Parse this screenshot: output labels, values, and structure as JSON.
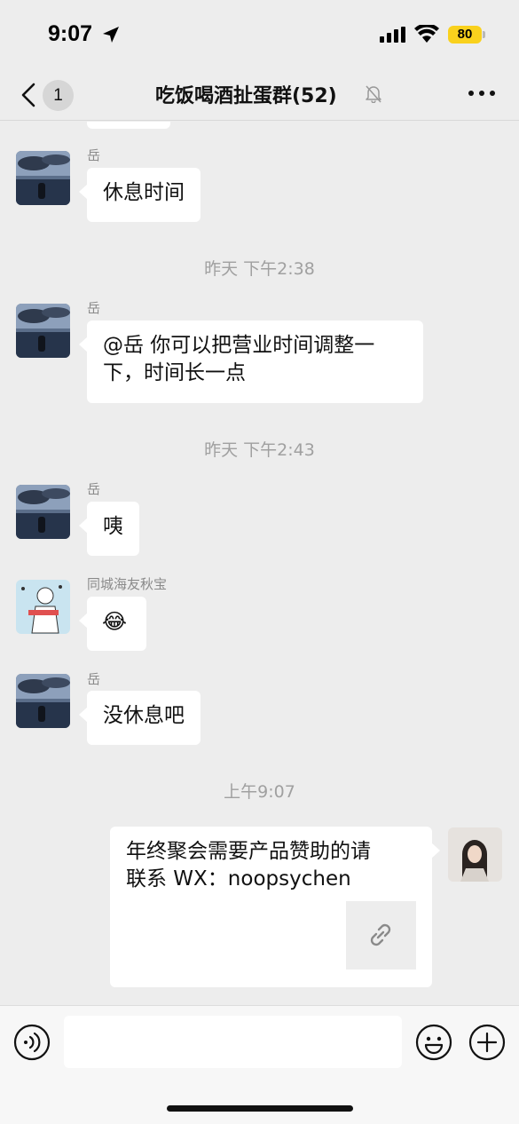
{
  "status_bar": {
    "time": "9:07",
    "battery": "80",
    "battery_color": "#f9d11d"
  },
  "nav": {
    "back_count": "1",
    "title": "吃饭喝酒扯蛋群(52)",
    "mute_icon": "bell-slash-icon",
    "more_icon": "more-dots-icon"
  },
  "messages": [
    {
      "sender": "岳",
      "text": "休息时间"
    },
    {
      "timestamp": "昨天 下午2:38"
    },
    {
      "sender": "岳",
      "text_line1": "@岳 你可以把营业时间调整一",
      "text_line2": "下，时间长一点"
    },
    {
      "timestamp": "昨天 下午2:43"
    },
    {
      "sender": "岳",
      "text": "咦"
    },
    {
      "sender": "同城海友秋宝",
      "emoji": "😂"
    },
    {
      "sender": "岳",
      "text": "没休息吧"
    },
    {
      "timestamp": "上午9:07"
    },
    {
      "sender": "self",
      "text_line1": "年终聚会需要产品赞助的请",
      "text_line2": "联系 WX：noopsychen",
      "attachment_icon": "link-icon"
    }
  ],
  "input_bar": {
    "placeholder": "",
    "voice_icon": "voice-icon",
    "emoji_icon": "emoji-icon",
    "plus_icon": "plus-icon"
  },
  "colors": {
    "background": "#ededed",
    "bubble": "#ffffff",
    "timestamp": "#a0a0a0"
  }
}
